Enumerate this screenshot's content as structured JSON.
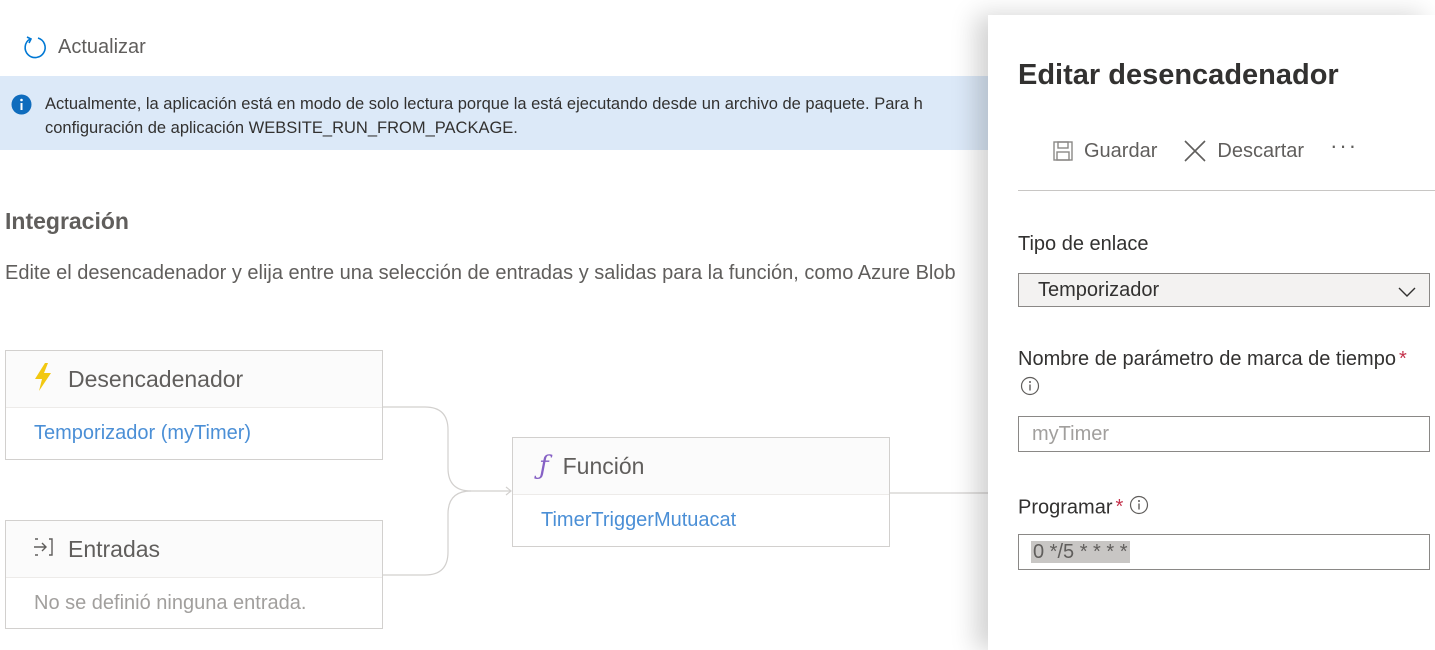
{
  "toolbar": {
    "refresh_label": "Actualizar",
    "refresh_icon": "refresh-icon"
  },
  "banner": {
    "line1": "Actualmente, la aplicación está en modo de solo lectura porque la está ejecutando desde un archivo de paquete. Para h",
    "line2": "configuración de aplicación WEBSITE_RUN_FROM_PACKAGE.",
    "icon": "info-icon"
  },
  "integration": {
    "title": "Integración",
    "description": "Edite el desencadenador y elija entre una selección de entradas y salidas para la función, como Azure Blob"
  },
  "cards": {
    "trigger": {
      "title": "Desencadenador",
      "value": "Temporizador (myTimer)",
      "icon": "lightning-icon"
    },
    "inputs": {
      "title": "Entradas",
      "value": "No se definió ninguna entrada.",
      "icon": "input-arrow-icon"
    },
    "function": {
      "title": "Función",
      "value": "TimerTriggerMutuacat",
      "icon": "function-icon"
    }
  },
  "panel": {
    "title": "Editar desencadenador",
    "save_label": "Guardar",
    "discard_label": "Descartar",
    "more_label": "···",
    "binding_type_label": "Tipo de enlace",
    "binding_type_value": "Temporizador",
    "timestamp_param_label": "Nombre de parámetro de marca de tiempo",
    "timestamp_param_value": "myTimer",
    "schedule_label": "Programar",
    "schedule_value": "0 */5 * * * *",
    "required_mark": "*"
  },
  "colors": {
    "link": "#4b8fd6",
    "banner_bg": "#dce9f8",
    "lightning": "#f2c811",
    "function_icon": "#8661c5",
    "required": "#c4314b"
  }
}
